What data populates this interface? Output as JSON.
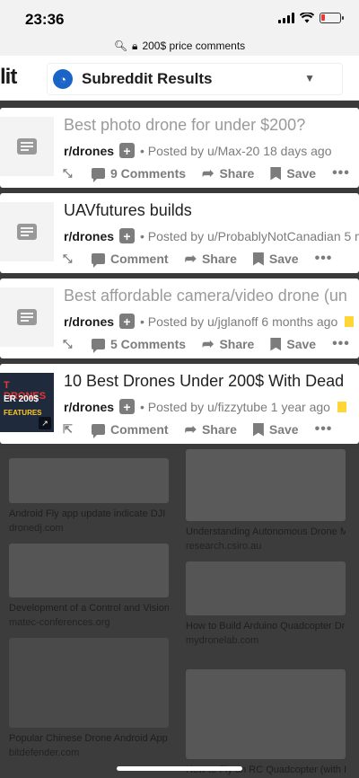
{
  "status_bar": {
    "time": "23:36"
  },
  "url_bar": {
    "text": "200$ price comments"
  },
  "header": {
    "logo_fragment": "lit",
    "subreddit_results_label": "Subreddit Results"
  },
  "posts": [
    {
      "title": "Best photo drone for under $200?",
      "subreddit": "r/drones",
      "posted_by": "• Posted by u/Max-20 18 days ago",
      "comments": "9 Comments",
      "share": "Share",
      "save": "Save"
    },
    {
      "title": "UAVfutures builds",
      "subreddit": "r/drones",
      "posted_by": "• Posted by u/ProbablyNotCanadian 5 m",
      "comments": "Comment",
      "share": "Share",
      "save": "Save"
    },
    {
      "title": "Best affordable camera/video drone (un",
      "subreddit": "r/drones",
      "posted_by": "• Posted by u/jglanoff 6 months ago",
      "comments": "5 Comments",
      "share": "Share",
      "save": "Save"
    },
    {
      "title": "10 Best Drones Under 200$ With Dead",
      "subreddit": "r/drones",
      "posted_by": "• Posted by u/fizzytube 1 year ago",
      "comments": "Comment",
      "share": "Share",
      "save": "Save",
      "thumb_text_1": "T DRONES",
      "thumb_text_2": "ER 200$",
      "thumb_text_3": "FEATURES"
    }
  ],
  "background_results": [
    {
      "title": "Android Fly app update indicate DJI F...",
      "source": "dronedj.com"
    },
    {
      "title": "Understanding Autonomous Drone M...",
      "source": "research.csiro.au"
    },
    {
      "title": "Development of a Control and Vision I...",
      "source": "matec-conferences.org"
    },
    {
      "title": "How to Build Arduino Quadcopter Dr...",
      "source": "mydronelab.com"
    },
    {
      "title": "Popular Chinese Drone Android App ...",
      "source": "bitdefender.com"
    },
    {
      "title": "How to Fly an RC Quadcopter (with P...",
      "source": ""
    }
  ],
  "colors": {
    "reddit_blue": "#1a64c8",
    "award_gold": "#ffd635",
    "battery_low": "#e53935"
  }
}
